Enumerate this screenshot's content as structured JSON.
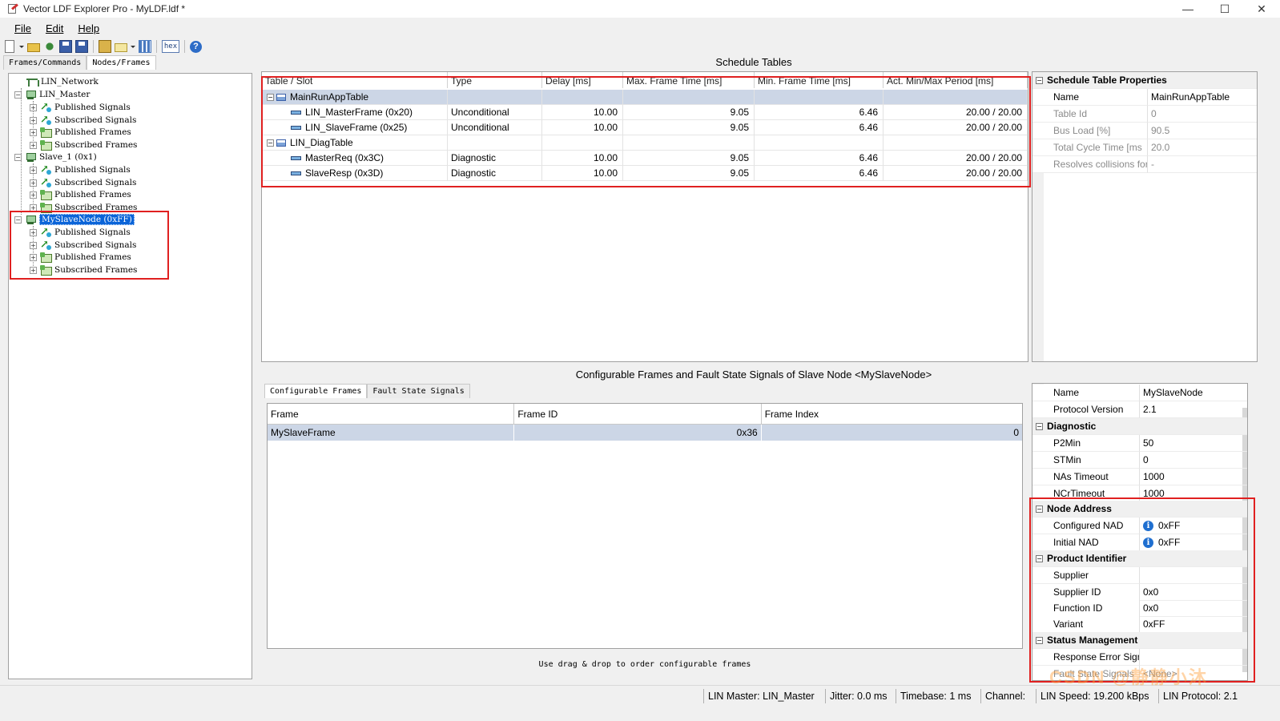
{
  "window": {
    "title": "Vector LDF Explorer Pro - MyLDF.ldf *",
    "minimize": "—",
    "maximize": "☐",
    "close": "✕"
  },
  "menu": {
    "file": "File",
    "edit": "Edit",
    "help": "Help"
  },
  "toolbar": {
    "hex_label": "hex",
    "help_label": "?"
  },
  "left_tabs": {
    "frames": "Frames/Commands",
    "nodes": "Nodes/Frames"
  },
  "tree": {
    "network": "LIN_Network",
    "master": "LIN_Master",
    "slave1": "Slave_1  (0x1)",
    "myslave": "MySlaveNode  (0xFF)",
    "published_signals": "Published Signals",
    "subscribed_signals": "Subscribed Signals",
    "published_frames": "Published Frames",
    "subscribed_frames": "Subscribed Frames"
  },
  "schedule": {
    "title": "Schedule Tables",
    "columns": [
      "Table / Slot",
      "Type",
      "Delay [ms]",
      "Max. Frame Time [ms]",
      "Min. Frame Time [ms]",
      "Act. Min/Max Period [ms]"
    ],
    "table1": "MainRunAppTable",
    "table2": "LIN_DiagTable",
    "rows": [
      {
        "slot": "LIN_MasterFrame (0x20)",
        "type": "Unconditional",
        "delay": "10.00",
        "max": "9.05",
        "min": "6.46",
        "period": "20.00 / 20.00"
      },
      {
        "slot": "LIN_SlaveFrame (0x25)",
        "type": "Unconditional",
        "delay": "10.00",
        "max": "9.05",
        "min": "6.46",
        "period": "20.00 / 20.00"
      },
      {
        "slot": "MasterReq (0x3C)",
        "type": "Diagnostic",
        "delay": "10.00",
        "max": "9.05",
        "min": "6.46",
        "period": "20.00 / 20.00"
      },
      {
        "slot": "SlaveResp (0x3D)",
        "type": "Diagnostic",
        "delay": "10.00",
        "max": "9.05",
        "min": "6.46",
        "period": "20.00 / 20.00"
      }
    ]
  },
  "sched_props": {
    "header": "Schedule Table Properties",
    "name_k": "Name",
    "name_v": "MainRunAppTable",
    "id_k": "Table Id",
    "id_v": "0",
    "load_k": "Bus Load [%]",
    "load_v": "90.5",
    "cycle_k": "Total Cycle Time [ms",
    "cycle_v": "20.0",
    "coll_k": "Resolves collisions for",
    "coll_v": "-"
  },
  "config": {
    "title": "Configurable Frames and Fault State Signals of Slave Node <MySlaveNode>",
    "tab1": "Configurable Frames",
    "tab2": "Fault State Signals",
    "col_frame": "Frame",
    "col_id": "Frame ID",
    "col_index": "Frame Index",
    "row_frame": "MySlaveFrame",
    "row_id": "0x36",
    "row_index": "0",
    "hint": "Use drag & drop to order configurable frames"
  },
  "node_props": {
    "name_k": "Name",
    "name_v": "MySlaveNode",
    "proto_k": "Protocol Version",
    "proto_v": "2.1",
    "diag": "Diagnostic",
    "p2min_k": "P2Min",
    "p2min_v": "50",
    "stmin_k": "STMin",
    "stmin_v": "0",
    "nas_k": "NAs Timeout",
    "nas_v": "1000",
    "ncr_k": "NCrTimeout",
    "ncr_v": "1000",
    "nodeaddr": "Node Address",
    "cnad_k": "Configured NAD",
    "cnad_v": "0xFF",
    "inad_k": "Initial NAD",
    "inad_v": "0xFF",
    "prodid": "Product Identifier",
    "supplier_k": "Supplier",
    "supplier_v": "",
    "supid_k": "Supplier ID",
    "supid_v": "0x0",
    "funcid_k": "Function ID",
    "funcid_v": "0x0",
    "variant_k": "Variant",
    "variant_v": "0xFF",
    "status": "Status Management",
    "resp_k": "Response Error Sign",
    "resp_v": "",
    "fault_k": "Fault State Signals",
    "fault_v": "<None>"
  },
  "status": {
    "master": "LIN Master: LIN_Master",
    "jitter": "Jitter: 0.0 ms",
    "timebase": "Timebase: 1 ms",
    "channel": "Channel:",
    "speed": "LIN Speed: 19.200 kBps",
    "protocol": "LIN Protocol: 2.1"
  },
  "watermark": "CSDN @静静小沐",
  "colors": {
    "highlight": "#e02020",
    "selection": "#0a64d8",
    "group_row": "#ccd6e6"
  }
}
